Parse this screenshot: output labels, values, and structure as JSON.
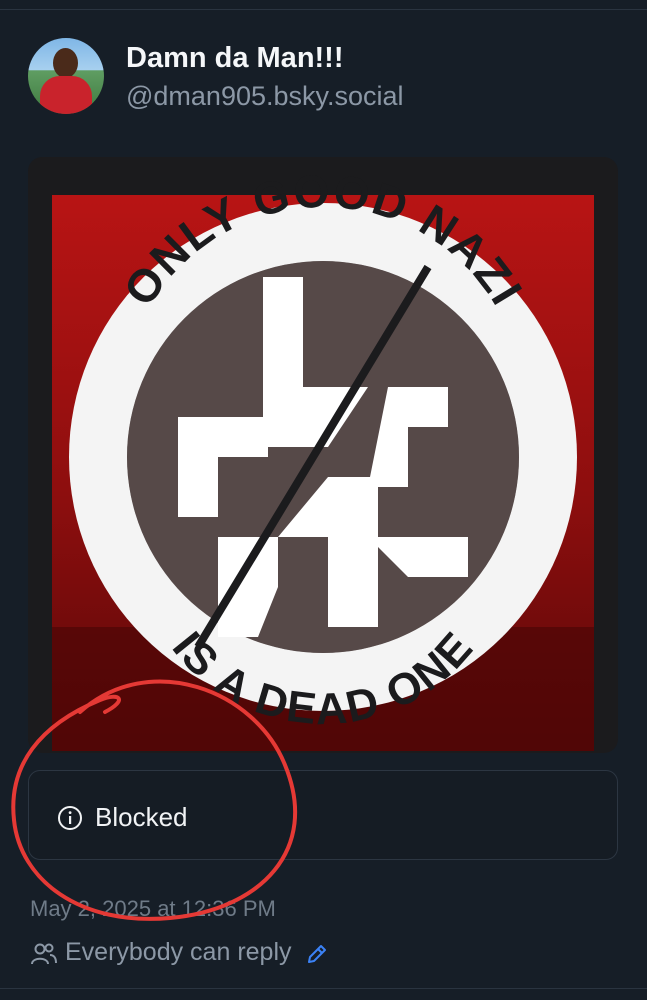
{
  "post": {
    "author": {
      "display_name": "Damn da Man!!!",
      "handle": "@dman905.bsky.social"
    },
    "image": {
      "top_text": "ONLY GOOD NAZI",
      "bottom_text": "IS A DEAD ONE"
    },
    "blocked_notice": {
      "label": "Blocked",
      "icon": "info-icon"
    },
    "timestamp": "May 2, 2025 at 12:36 PM",
    "reply_setting": {
      "label": "Everybody can reply",
      "icon": "people-icon",
      "edit_icon": "pencil-icon"
    }
  },
  "colors": {
    "background": "#161e27",
    "accent": "#3b82f6",
    "muted_text": "#8c98a6",
    "annotation_circle": "#e53935"
  }
}
